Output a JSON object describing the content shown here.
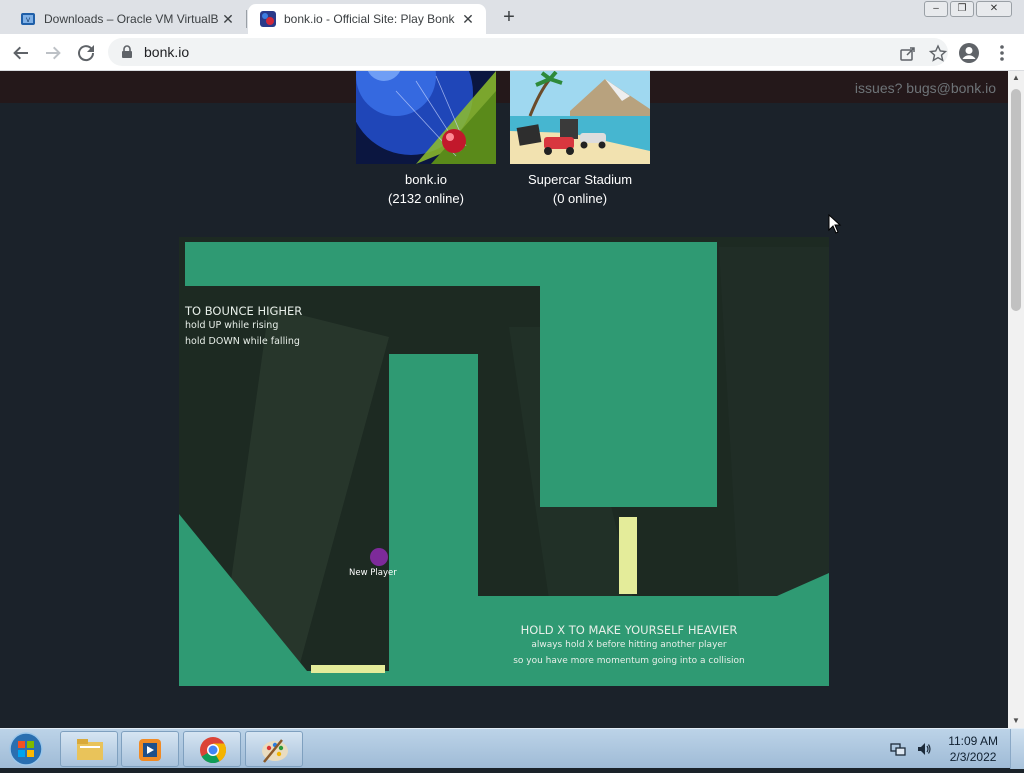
{
  "browser": {
    "tabs": [
      {
        "title": "Downloads – Oracle VM VirtualB",
        "active": false,
        "favicon": "virtualbox-icon"
      },
      {
        "title": "bonk.io - Official Site: Play Bonk",
        "active": true,
        "favicon": "bonk-icon"
      }
    ],
    "close_glyph": "✕",
    "new_tab_glyph": "+",
    "url": "bonk.io",
    "window_buttons": {
      "minimize": "–",
      "maximize": "❐",
      "close": "✕"
    }
  },
  "page": {
    "header_contact": "issues? bugs@bonk.io",
    "games": [
      {
        "name": "bonk.io",
        "online": "(2132 online)"
      },
      {
        "name": "Supercar Stadium",
        "online": "(0 online)"
      }
    ],
    "tutorial": {
      "tip1_title": "TO BOUNCE HIGHER",
      "tip1_line1": "hold UP while rising",
      "tip1_line2": "hold DOWN while falling",
      "tip2_title": "HOLD X TO MAKE YOURSELF HEAVIER",
      "tip2_line1": "always hold X before hitting another player",
      "tip2_line2": "so you have more momentum going into a collision",
      "player_name": "New Player"
    }
  },
  "taskbar": {
    "time": "11:09 AM",
    "date": "2/3/2022",
    "pinned": [
      "file-explorer-icon",
      "media-player-icon",
      "chrome-icon",
      "paint-icon"
    ]
  },
  "colors": {
    "platform": "#2f9a73",
    "pad": "#e4ec9a",
    "player": "#7d2a9a",
    "background": "#1b222a"
  }
}
